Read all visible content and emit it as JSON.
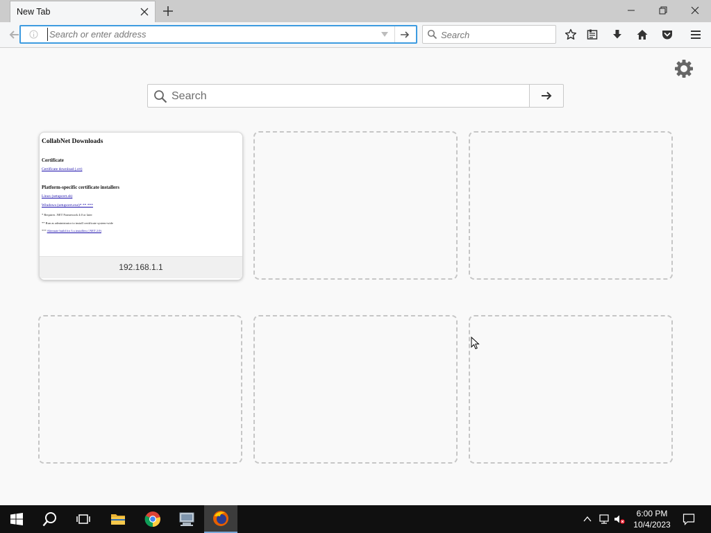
{
  "window": {
    "tab_title": "New Tab"
  },
  "navbar": {
    "address_placeholder": "Search or enter address",
    "search_placeholder": "Search"
  },
  "newtab": {
    "search_placeholder": "Search",
    "tiles": [
      {
        "type": "site",
        "label": "192.168.1.1",
        "thumbnail": {
          "title": "CollabNet Downloads",
          "section1": "Certificate",
          "link1": "Certificate download (.crt)",
          "section2": "Platform-specific certificate installers",
          "link2": "Linux (setupcert.sh)",
          "link3": "Windows (setupcert.exe)* ** ***",
          "note1": "* Requires .NET Framework 4.0 or later",
          "note2": "** Run as administrator to install certificate system-wide",
          "note3_prefix": "***",
          "note3_link": "Alternate build for 3.x installers (.NET 2.0)"
        }
      },
      {
        "type": "placeholder"
      },
      {
        "type": "placeholder"
      },
      {
        "type": "placeholder"
      },
      {
        "type": "placeholder"
      },
      {
        "type": "placeholder"
      }
    ]
  },
  "taskbar": {
    "time": "6:00 PM",
    "date": "10/4/2023"
  },
  "colors": {
    "focus_ring": "#3d9be0",
    "taskbar_bg": "#101010",
    "tab_strip_bg": "#cccccc"
  }
}
